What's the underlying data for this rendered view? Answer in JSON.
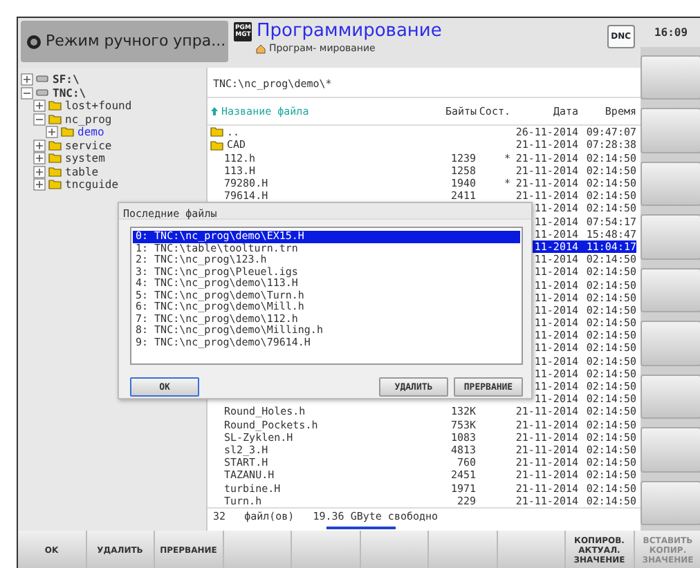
{
  "header": {
    "machine_mode": {
      "label": "Режим ручного упра..."
    },
    "programming_mode": {
      "icon_lines": [
        "PGM",
        "MGT"
      ],
      "title": "Программирование",
      "subtitle": "Програм- мирование"
    },
    "dnc_label": "DNC",
    "time": "16:09"
  },
  "tree": [
    {
      "kind": "drive",
      "label": "SF:\\",
      "expanded": false,
      "selected": false
    },
    {
      "kind": "drive",
      "label": "TNC:\\",
      "expanded": true,
      "selected": false,
      "children": [
        {
          "kind": "folder",
          "label": "lost+found",
          "expanded": false,
          "selected": false
        },
        {
          "kind": "folder",
          "label": "nc_prog",
          "expanded": true,
          "selected": false,
          "children": [
            {
              "kind": "folder",
              "label": "demo",
              "expanded": false,
              "selected": true
            }
          ]
        },
        {
          "kind": "folder",
          "label": "service",
          "expanded": false,
          "selected": false
        },
        {
          "kind": "folder",
          "label": "system",
          "expanded": false,
          "selected": false
        },
        {
          "kind": "folder",
          "label": "table",
          "expanded": false,
          "selected": false
        },
        {
          "kind": "folder",
          "label": "tncguide",
          "expanded": false,
          "selected": false
        }
      ]
    }
  ],
  "path": "TNC:\\nc_prog\\demo\\*",
  "columns": {
    "name": "Название файла",
    "bytes": "Байты",
    "status": "Сост.",
    "date": "Дата",
    "time": "Время"
  },
  "files": [
    {
      "kind": "folder",
      "name": "..",
      "date": "26-11-2014",
      "time": "09:47:07",
      "selected": false
    },
    {
      "kind": "folder",
      "name": "CAD",
      "date": "21-11-2014",
      "time": "07:28:38",
      "selected": false
    },
    {
      "kind": "file",
      "name": "112.h",
      "bytes": "1239",
      "status": "*",
      "date": "21-11-2014",
      "time": "02:14:50",
      "selected": false
    },
    {
      "kind": "file",
      "name": "113.H",
      "bytes": "1258",
      "date": "21-11-2014",
      "time": "02:14:50",
      "selected": false
    },
    {
      "kind": "file",
      "name": "79280.H",
      "bytes": "1940",
      "status": "*",
      "date": "21-11-2014",
      "time": "02:14:50",
      "selected": false
    },
    {
      "kind": "file",
      "name": "79614.H",
      "bytes": "2411",
      "date": "21-11-2014",
      "time": "02:14:50",
      "selected": false
    },
    {
      "kind": "partial",
      "date": "11-2014",
      "time": "02:14:50",
      "selected": false
    },
    {
      "kind": "partial",
      "date": "11-2014",
      "time": "07:54:17",
      "selected": false
    },
    {
      "kind": "partial",
      "date": "11-2014",
      "time": "15:48:47",
      "selected": false
    },
    {
      "kind": "partial",
      "date": "11-2014",
      "time": "11:04:17",
      "selected": true
    },
    {
      "kind": "partial",
      "date": "11-2014",
      "time": "02:14:50",
      "selected": false
    },
    {
      "kind": "partial",
      "date": "11-2014",
      "time": "02:14:50",
      "selected": false
    },
    {
      "kind": "partial",
      "date": "11-2014",
      "time": "02:14:50",
      "selected": false
    },
    {
      "kind": "partial",
      "date": "11-2014",
      "time": "02:14:50",
      "selected": false
    },
    {
      "kind": "partial",
      "date": "11-2014",
      "time": "02:14:50",
      "selected": false
    },
    {
      "kind": "partial",
      "date": "11-2014",
      "time": "02:14:50",
      "selected": false
    },
    {
      "kind": "partial",
      "date": "11-2014",
      "time": "02:14:50",
      "selected": false
    },
    {
      "kind": "partial",
      "date": "11-2014",
      "time": "02:14:50",
      "selected": false
    },
    {
      "kind": "partial",
      "date": "11-2014",
      "time": "02:14:50",
      "selected": false
    },
    {
      "kind": "partial",
      "date": "11-2014",
      "time": "02:14:50",
      "selected": false
    },
    {
      "kind": "partial",
      "date": "11-2014",
      "time": "02:14:50",
      "selected": false
    },
    {
      "kind": "partial",
      "date": "11-2014",
      "time": "02:14:50",
      "selected": false
    },
    {
      "kind": "file",
      "name": "Round_Holes.h",
      "bytes": "132K",
      "date": "21-11-2014",
      "time": "02:14:50",
      "selected": false
    },
    {
      "kind": "file",
      "name": "Round_Pockets.h",
      "bytes": "753K",
      "date": "21-11-2014",
      "time": "02:14:50",
      "selected": false
    },
    {
      "kind": "file",
      "name": "SL-Zyklen.H",
      "bytes": "1083",
      "date": "21-11-2014",
      "time": "02:14:50",
      "selected": false
    },
    {
      "kind": "file",
      "name": "sl2_3.H",
      "bytes": "4813",
      "date": "21-11-2014",
      "time": "02:14:50",
      "selected": false
    },
    {
      "kind": "file",
      "name": "START.H",
      "bytes": "760",
      "date": "21-11-2014",
      "time": "02:14:50",
      "selected": false
    },
    {
      "kind": "file",
      "name": "TAZANU.H",
      "bytes": "2451",
      "date": "21-11-2014",
      "time": "02:14:50",
      "selected": false
    },
    {
      "kind": "file",
      "name": "turbine.H",
      "bytes": "1971",
      "date": "21-11-2014",
      "time": "02:14:50",
      "selected": false
    },
    {
      "kind": "file",
      "name": "Turn.h",
      "bytes": "229",
      "date": "21-11-2014",
      "time": "02:14:50",
      "selected": false
    }
  ],
  "footer": "32   файл(ов)   19.36 GByte свободно",
  "dialog": {
    "title": "Последние файлы",
    "items": [
      {
        "text": "0: TNC:\\nc_prog\\demo\\EX15.H",
        "selected": true
      },
      {
        "text": "1: TNC:\\table\\toolturn.trn",
        "selected": false
      },
      {
        "text": "2: TNC:\\nc_prog\\123.h",
        "selected": false
      },
      {
        "text": "3: TNC:\\nc_prog\\Pleuel.igs",
        "selected": false
      },
      {
        "text": "4: TNC:\\nc_prog\\demo\\113.H",
        "selected": false
      },
      {
        "text": "5: TNC:\\nc_prog\\demo\\Turn.h",
        "selected": false
      },
      {
        "text": "6: TNC:\\nc_prog\\demo\\Mill.h",
        "selected": false
      },
      {
        "text": "7: TNC:\\nc_prog\\demo\\112.h",
        "selected": false
      },
      {
        "text": "8: TNC:\\nc_prog\\demo\\Milling.h",
        "selected": false
      },
      {
        "text": "9: TNC:\\nc_prog\\demo\\79614.H",
        "selected": false
      }
    ],
    "buttons": [
      {
        "label": "OK",
        "kind": "default"
      },
      {
        "label": "УДАЛИТЬ",
        "kind": "normal"
      },
      {
        "label": "ПРЕРВАНИЕ",
        "kind": "normal"
      }
    ]
  },
  "softkeys": [
    {
      "kind": "label",
      "lines": [
        "OK"
      ],
      "disabled": false
    },
    {
      "kind": "label",
      "lines": [
        "УДАЛИТЬ"
      ],
      "disabled": false
    },
    {
      "kind": "label",
      "lines": [
        "ПРЕРВАНИЕ"
      ],
      "disabled": false
    },
    {
      "kind": "blank"
    },
    {
      "kind": "blank"
    },
    {
      "kind": "blank"
    },
    {
      "kind": "blank"
    },
    {
      "kind": "blank"
    },
    {
      "kind": "label",
      "lines": [
        "КОПИРОВ.",
        "АКТУАЛ.",
        "ЗНАЧЕНИЕ"
      ],
      "disabled": false
    },
    {
      "kind": "label",
      "lines": [
        "ВСТАВИТЬ",
        "КОПИР.",
        "ЗНАЧЕНИЕ"
      ],
      "disabled": true
    }
  ]
}
